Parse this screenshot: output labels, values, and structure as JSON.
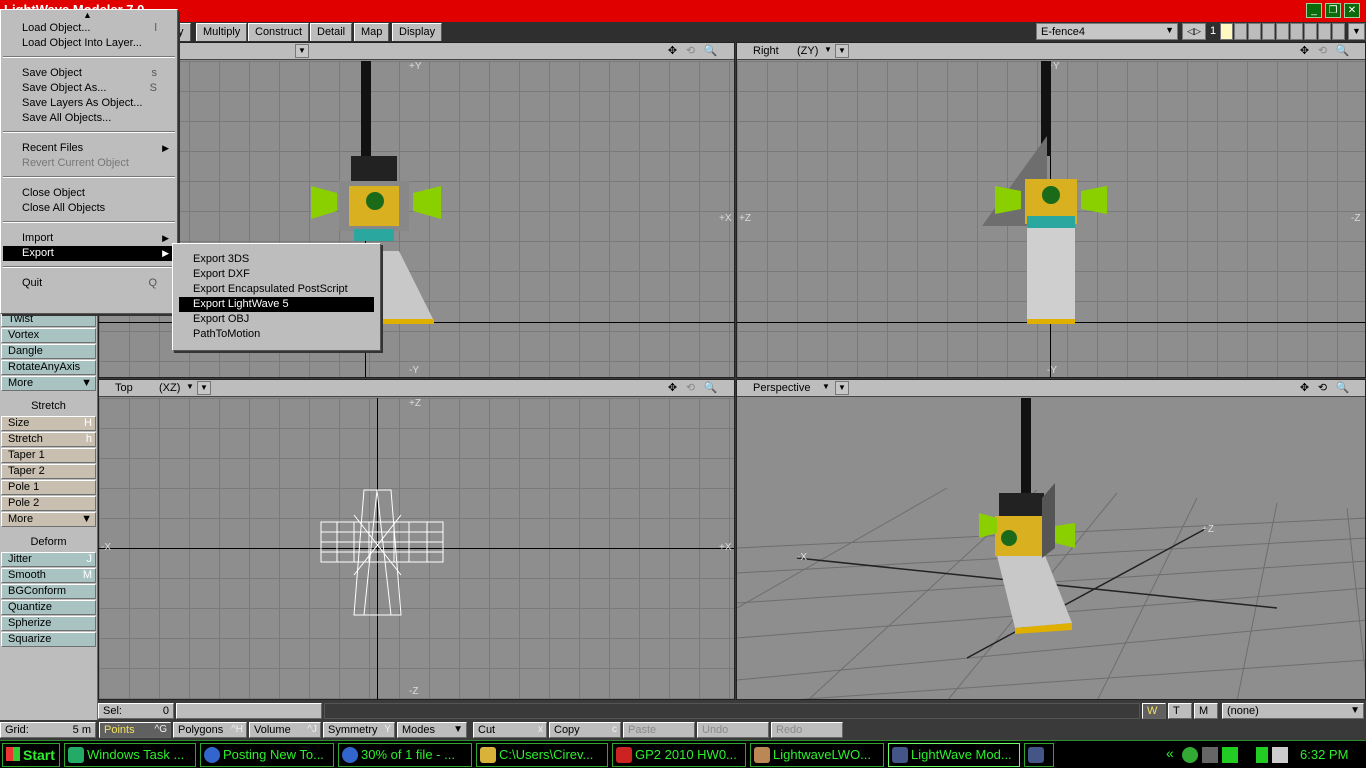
{
  "app": {
    "title": "LightWave Modeler 7.0"
  },
  "tabs": [
    "fy",
    "Multiply",
    "Construct",
    "Detail",
    "Map",
    "Display"
  ],
  "layer": {
    "name": "E-fence4",
    "number": "1"
  },
  "toolbar": {
    "upper_items": [
      {
        "label": "Twist"
      },
      {
        "label": "Vortex"
      },
      {
        "label": "Dangle"
      },
      {
        "label": "RotateAnyAxis"
      }
    ],
    "more1": "More",
    "stretch_header": "Stretch",
    "stretch_items": [
      {
        "label": "Size",
        "key": "H"
      },
      {
        "label": "Stretch",
        "key": "h"
      },
      {
        "label": "Taper 1",
        "key": ""
      },
      {
        "label": "Taper 2",
        "key": ""
      },
      {
        "label": "Pole 1",
        "key": ""
      },
      {
        "label": "Pole 2",
        "key": ""
      }
    ],
    "more2": "More",
    "deform_header": "Deform",
    "deform_items": [
      {
        "label": "Jitter",
        "key": "J"
      },
      {
        "label": "Smooth",
        "key": "M"
      },
      {
        "label": "BGConform",
        "key": ""
      },
      {
        "label": "Quantize",
        "key": ""
      },
      {
        "label": "Spherize",
        "key": ""
      },
      {
        "label": "Squarize",
        "key": ""
      }
    ]
  },
  "viewports": {
    "top_left": {
      "axis_top": "+Y",
      "axis_right": "+X",
      "axis_bottom": "-Y"
    },
    "top_right": {
      "label": "Right",
      "axes": "(ZY)",
      "axis_top": "+Y",
      "axis_left": "+Z",
      "axis_right": "-Z",
      "axis_bottom": "-Y"
    },
    "bottom_left": {
      "label": "Top",
      "axes": "(XZ)",
      "axis_top": "+Z",
      "axis_left": "-X",
      "axis_right": "+X",
      "axis_bottom": "-Z"
    },
    "bottom_right": {
      "label": "Perspective",
      "axis_z": "+Z",
      "axis_x": "-X"
    }
  },
  "status": {
    "sel_label": "Sel:",
    "sel_value": "0",
    "mode_w": "W",
    "mode_t": "T",
    "mode_m": "M",
    "surface": "(none)"
  },
  "bottom": {
    "grid_label": "Grid:",
    "grid_value": "5 m",
    "points": "Points",
    "points_key": "^G",
    "polygons": "Polygons",
    "polygons_key": "^H",
    "volume": "Volume",
    "volume_key": "^J",
    "symmetry": "Symmetry",
    "symmetry_key": "Y",
    "modes": "Modes",
    "cut": "Cut",
    "cut_key": "x",
    "copy": "Copy",
    "copy_key": "c",
    "paste": "Paste",
    "undo": "Undo",
    "redo": "Redo"
  },
  "file_menu": {
    "items": [
      {
        "label": "Load Object...",
        "key": "l"
      },
      {
        "label": "Load Object Into Layer...",
        "key": ""
      },
      {
        "label": "Save Object",
        "key": "s"
      },
      {
        "label": "Save Object As...",
        "key": "S"
      },
      {
        "label": "Save Layers As Object...",
        "key": ""
      },
      {
        "label": "Save All Objects...",
        "key": ""
      },
      {
        "label": "Recent Files",
        "key": ""
      },
      {
        "label": "Revert Current Object",
        "key": ""
      },
      {
        "label": "Close Object",
        "key": ""
      },
      {
        "label": "Close All Objects",
        "key": ""
      },
      {
        "label": "Import",
        "key": ""
      },
      {
        "label": "Export",
        "key": ""
      },
      {
        "label": "Quit",
        "key": "Q"
      }
    ]
  },
  "export_menu": {
    "items": [
      "Export 3DS",
      "Export DXF",
      "Export Encapsulated PostScript",
      "Export LightWave 5",
      "Export OBJ",
      "PathToMotion"
    ]
  },
  "taskbar": {
    "start": "Start",
    "tasks": [
      "Windows Task ...",
      "Posting New To...",
      "30% of 1 file - ...",
      "C:\\Users\\Cirev...",
      "GP2 2010 HW0...",
      "LightwaveLWO...",
      "LightWave Mod..."
    ],
    "tray_arrow": "«",
    "clock": "6:32 PM"
  },
  "colors": {
    "titlebar": "#e00000",
    "taskbar_text": "#2eee2e",
    "viewport_bg": "#8e8e8e"
  }
}
